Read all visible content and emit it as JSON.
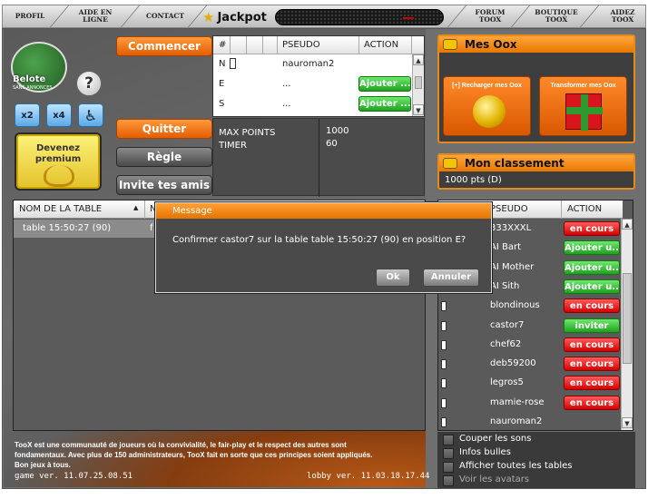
{
  "nav": {
    "profil": "PROFIL",
    "aide": [
      "AIDE EN",
      "LIGNE"
    ],
    "contact": "CONTACT",
    "jackpot": "Jackpot",
    "forum": [
      "FORUM",
      "TOOX"
    ],
    "boutique": [
      "BOUTIQUE",
      "TOOX"
    ],
    "aidez": [
      "AIDEZ",
      "TOOX"
    ]
  },
  "logo": {
    "title": "Belote",
    "subtitle": "SANS ANNONCES"
  },
  "help_label": "?",
  "premium": [
    "Devenez",
    "premium"
  ],
  "buttons": {
    "commencer": "Commencer",
    "quitter": "Quitter",
    "regle": "Règle",
    "invite": "Invite tes amis"
  },
  "icons": [
    "x2",
    "x4"
  ],
  "players_table": {
    "headers": [
      "#",
      "PSEUDO",
      "ACTION"
    ],
    "rows": [
      {
        "seat": "N",
        "pseudo": "nauroman2",
        "action": ""
      },
      {
        "seat": "E",
        "pseudo": "...",
        "action": "Ajouter ..."
      },
      {
        "seat": "S",
        "pseudo": "...",
        "action": "Ajouter ..."
      }
    ]
  },
  "params": [
    {
      "label": "MAX POINTS",
      "value": "1000"
    },
    {
      "label": "TIMER",
      "value": "60"
    }
  ],
  "table_list": {
    "headers": [
      "NOM DE LA TABLE",
      "N"
    ],
    "rows": [
      {
        "name": "table 15:50:27 (90)",
        "col2": "f"
      }
    ]
  },
  "about": [
    "TooX est une communauté de joueurs où la convivialité, le fair-play et le respect des autres sont",
    "fondamentaux. Avec plus de 150 administrateurs, TooX fait en sorte que ces principes soient appliqués.",
    "Bon jeux à tous."
  ],
  "version_game": "game ver. 11.07.25.08.51",
  "version_lobby": "lobby ver. 11.03.18.17.44",
  "oox": {
    "title": "Mes Oox",
    "recharger": "[+] Recharger mes Oox",
    "transformer": "Transformer mes Oox"
  },
  "classement": {
    "title": "Mon classement",
    "value": "1000 pts (D)"
  },
  "player_list": {
    "headers": [
      "PSEUDO",
      "ACTION"
    ],
    "rows": [
      {
        "pseudo": "333XXXL",
        "action": "en cours",
        "color": "red"
      },
      {
        "pseudo": "AI Bart",
        "action": "Ajouter u...",
        "color": "green"
      },
      {
        "pseudo": "AI Mother",
        "action": "Ajouter u...",
        "color": "green"
      },
      {
        "pseudo": "AI Sith",
        "action": "Ajouter u...",
        "color": "green"
      },
      {
        "pseudo": "blondinous",
        "action": "en cours",
        "color": "red"
      },
      {
        "pseudo": "castor7",
        "action": "inviter",
        "color": "green"
      },
      {
        "pseudo": "chef62",
        "action": "en cours",
        "color": "red"
      },
      {
        "pseudo": "deb59200",
        "action": "en cours",
        "color": "red"
      },
      {
        "pseudo": "legros5",
        "action": "en cours",
        "color": "red"
      },
      {
        "pseudo": "mamie-rose",
        "action": "en cours",
        "color": "red"
      },
      {
        "pseudo": "nauroman2",
        "action": "",
        "color": ""
      }
    ]
  },
  "options": [
    "Couper les sons",
    "Infos bulles",
    "Afficher toutes les tables",
    "Voir les avatars"
  ],
  "dialog": {
    "title": "Message",
    "message": "Confirmer castor7  sur la table  table 15:50:27 (90) en  position E?",
    "ok": "Ok",
    "cancel": "Annuler"
  },
  "colors": {
    "accent": "#e77800",
    "panel": "#3e3e3e",
    "green": "#1fa21f",
    "red": "#d60000"
  }
}
